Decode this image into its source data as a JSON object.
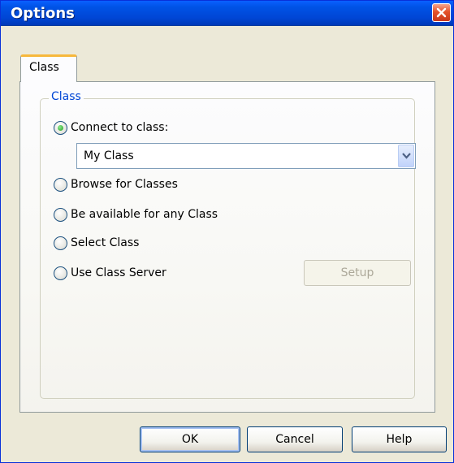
{
  "window": {
    "title": "Options"
  },
  "tabs": [
    {
      "label": "Class",
      "selected": true
    }
  ],
  "group": {
    "legend": "Class",
    "options": [
      {
        "label": "Connect to class:",
        "checked": true
      },
      {
        "label": "Browse for Classes",
        "checked": false
      },
      {
        "label": "Be available for any Class",
        "checked": false
      },
      {
        "label": "Select Class",
        "checked": false
      },
      {
        "label": "Use Class Server",
        "checked": false
      }
    ],
    "class_select": {
      "value": "My Class"
    },
    "setup_label": "Setup"
  },
  "buttons": {
    "ok": "OK",
    "cancel": "Cancel",
    "help": "Help"
  },
  "colors": {
    "title_bar": "#0054e3",
    "close_button": "#e4522a",
    "tab_accent": "#f7b83c",
    "legend": "#0046d5"
  },
  "icons": {
    "close": "close-icon",
    "dropdown": "chevron-down-icon"
  }
}
